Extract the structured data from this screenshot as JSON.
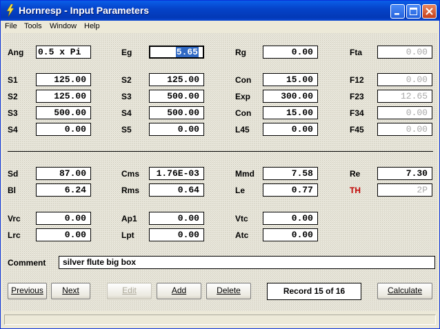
{
  "window": {
    "title": "Hornresp - Input Parameters"
  },
  "menu": [
    "File",
    "Tools",
    "Window",
    "Help"
  ],
  "labels": {
    "ang": "Ang",
    "eg": "Eg",
    "rg": "Rg",
    "fta": "Fta",
    "s1": "S1",
    "s2a": "S2",
    "con1": "Con",
    "f12": "F12",
    "s2b": "S2",
    "s3a": "S3",
    "exp": "Exp",
    "f23": "F23",
    "s3b": "S3",
    "s4a": "S4",
    "con2": "Con",
    "f34": "F34",
    "s4b": "S4",
    "s5": "S5",
    "l45": "L45",
    "f45": "F45",
    "sd": "Sd",
    "cms": "Cms",
    "mmd": "Mmd",
    "re": "Re",
    "bl": "Bl",
    "rms": "Rms",
    "le": "Le",
    "th": "TH",
    "vrc": "Vrc",
    "ap1": "Ap1",
    "vtc": "Vtc",
    "lrc": "Lrc",
    "lpt": "Lpt",
    "atc": "Atc",
    "comment": "Comment"
  },
  "values": {
    "ang": "0.5 x Pi",
    "eg": "5.65",
    "rg": "0.00",
    "fta": "0.00",
    "s1": "125.00",
    "s2a": "125.00",
    "con1": "15.00",
    "f12": "0.00",
    "s2b": "125.00",
    "s3a": "500.00",
    "exp": "300.00",
    "f23": "12.65",
    "s3b": "500.00",
    "s4a": "500.00",
    "con2": "15.00",
    "f34": "0.00",
    "s4b": "0.00",
    "s5": "0.00",
    "l45": "0.00",
    "f45": "0.00",
    "sd": "87.00",
    "cms": "1.76E-03",
    "mmd": "7.58",
    "re": "7.30",
    "bl": "6.24",
    "rms": "0.64",
    "le": "0.77",
    "th": "2P",
    "vrc": "0.00",
    "ap1": "0.00",
    "vtc": "0.00",
    "lrc": "0.00",
    "lpt": "0.00",
    "atc": "0.00",
    "comment": "silver flute big box"
  },
  "buttons": {
    "previous": "Previous",
    "next": "Next",
    "edit": "Edit",
    "add": "Add",
    "delete": "Delete",
    "calculate": "Calculate"
  },
  "record": "Record 15 of 16",
  "colors": {
    "title_bar": "#0543c9",
    "selection": "#316ac5",
    "th_label": "#c00000"
  }
}
